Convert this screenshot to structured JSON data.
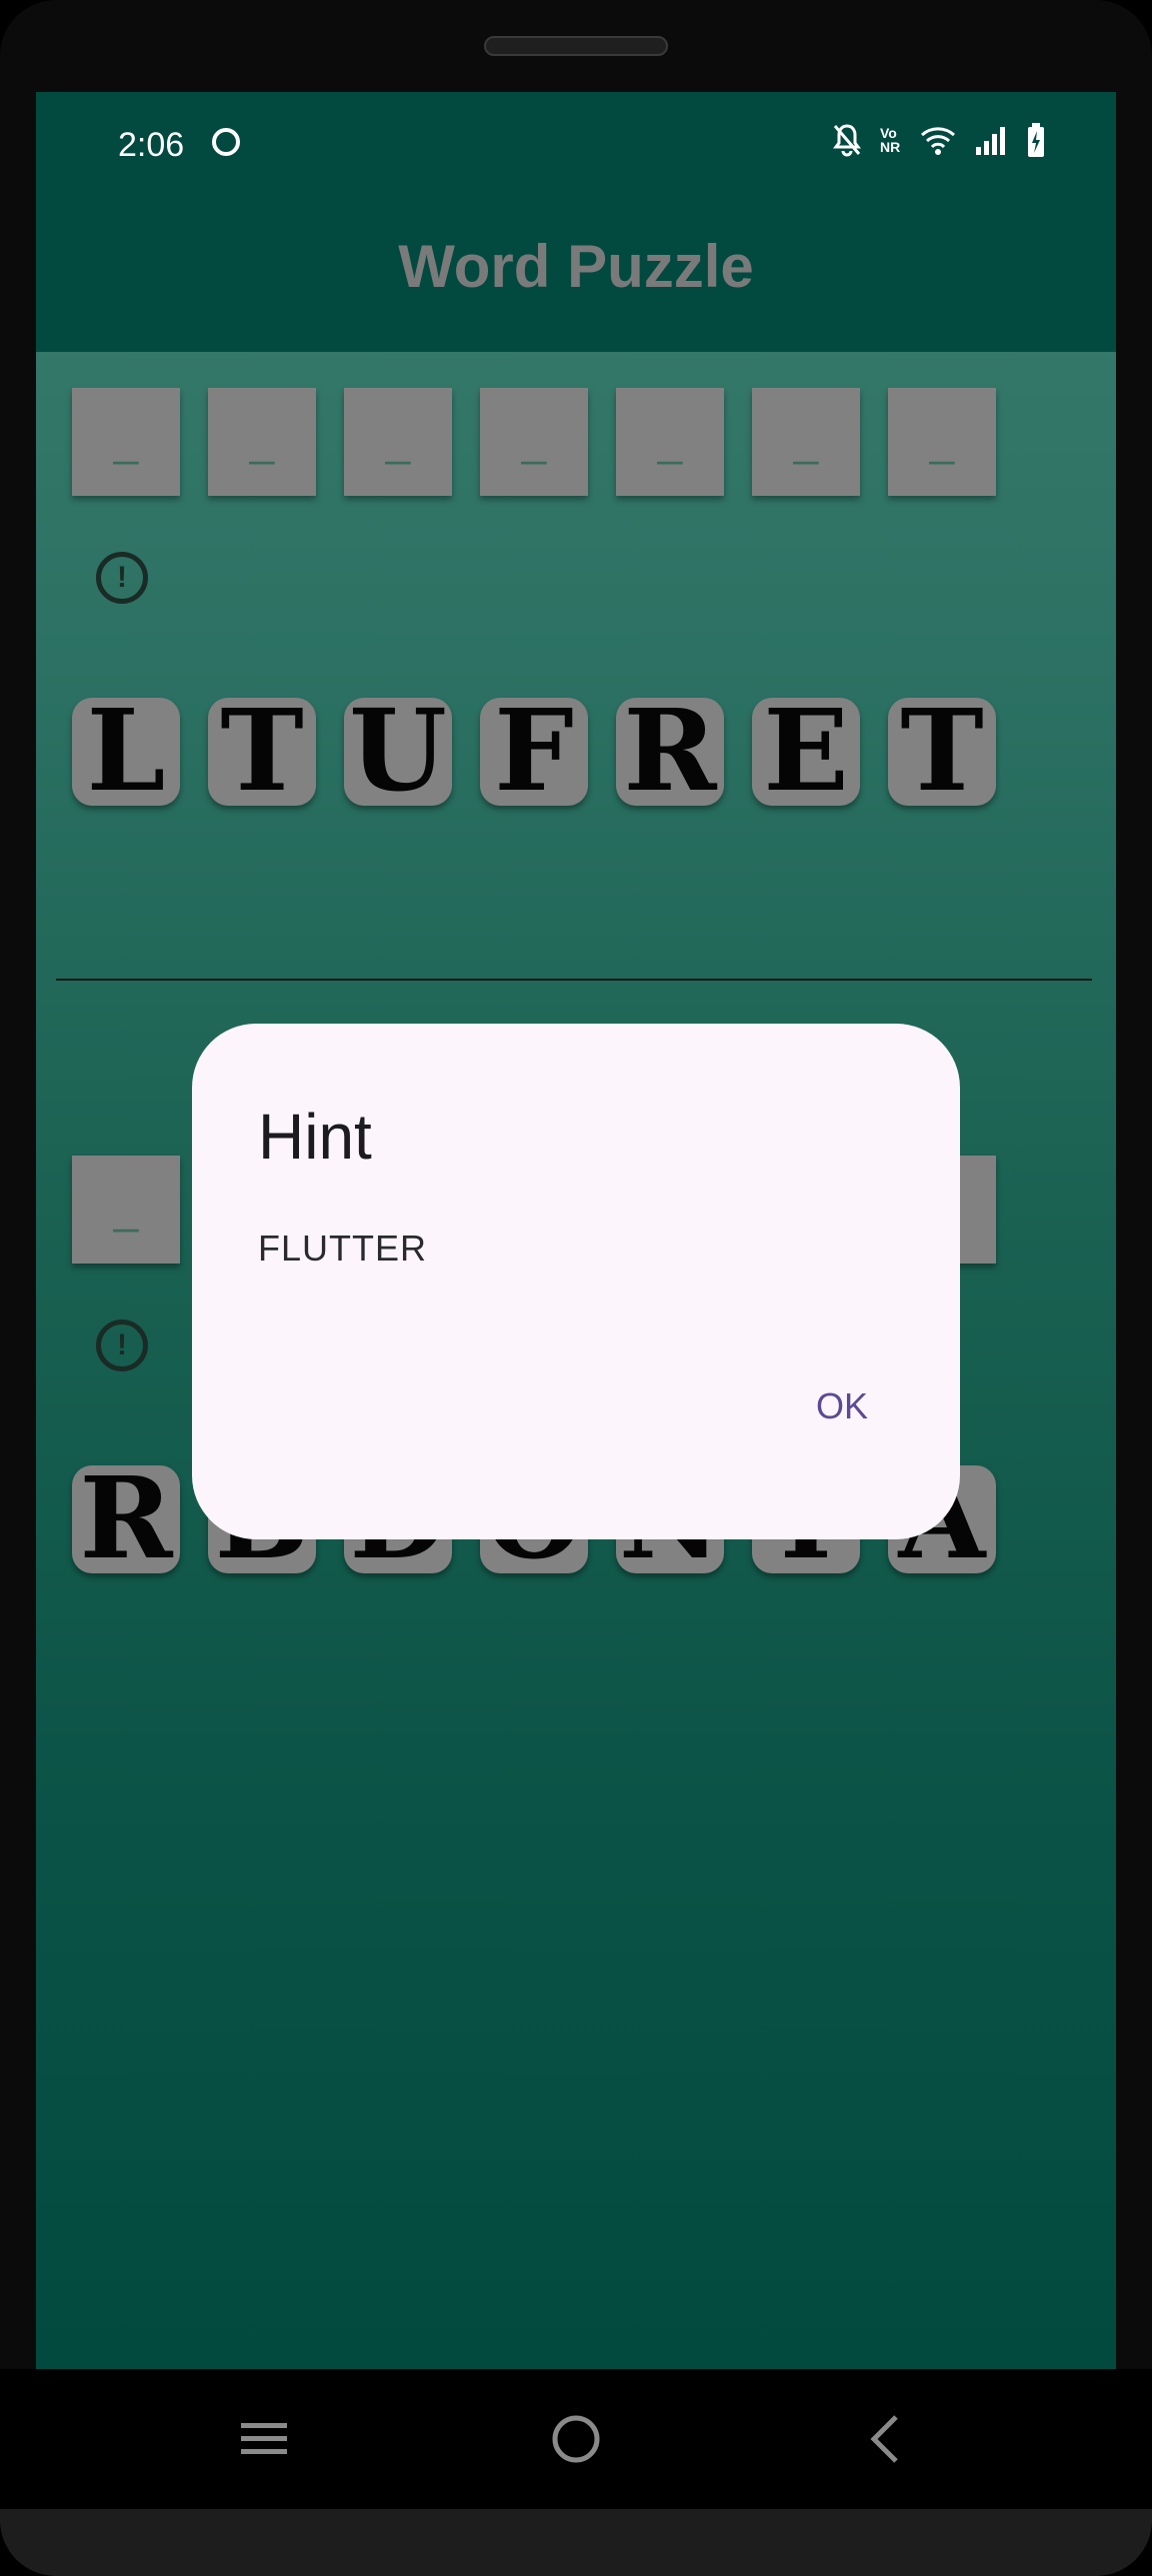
{
  "status_bar": {
    "time": "2:06",
    "icons": [
      "face-icon",
      "mute-bell-icon",
      "vonr-icon",
      "wifi-icon",
      "signal-icon",
      "battery-charging-icon"
    ],
    "vonr_text": "Vo NR"
  },
  "app_bar": {
    "title": "Word Puzzle"
  },
  "puzzles": [
    {
      "slots": [
        "_",
        "_",
        "_",
        "_",
        "_",
        "_",
        "_"
      ],
      "hint_icon_glyph": "!",
      "tiles": [
        "L",
        "T",
        "U",
        "F",
        "R",
        "E",
        "T"
      ]
    },
    {
      "slots": [
        "_",
        "_",
        "_",
        "_",
        "_",
        "_",
        "_"
      ],
      "hint_icon_glyph": "!",
      "tiles": [
        "R",
        "B",
        "D",
        "O",
        "N",
        "I",
        "A"
      ]
    }
  ],
  "dialog": {
    "title": "Hint",
    "body": "FLUTTER",
    "ok_label": "OK"
  },
  "nav_bar": {
    "buttons": [
      "recents-icon",
      "home-icon",
      "back-icon"
    ]
  },
  "colors": {
    "app_bar": "#024a40",
    "title_text": "#7a7a7a",
    "tile": "#828282",
    "dialog_bg": "#fcf5fb",
    "dialog_action": "#5a4a94"
  }
}
